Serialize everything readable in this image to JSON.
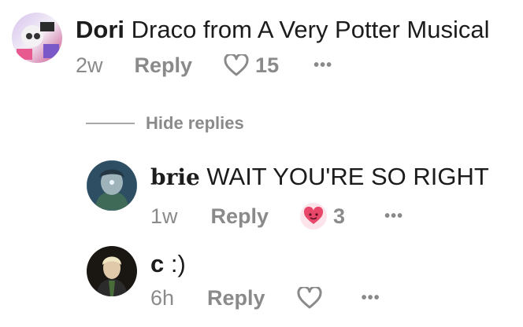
{
  "comments": [
    {
      "author": "Dori",
      "text": "Draco from A Very Potter Musical",
      "time": "2w",
      "reply_label": "Reply",
      "likes": "15",
      "more": "•••"
    },
    {
      "author": "brie",
      "text": "WAIT YOU'RE SO RIGHT",
      "time": "1w",
      "reply_label": "Reply",
      "likes": "3",
      "more": "•••"
    },
    {
      "author": "c",
      "text": ":)",
      "time": "6h",
      "reply_label": "Reply",
      "more": "•••"
    }
  ],
  "hide_replies_label": "Hide replies",
  "icons": {
    "heart": "heart-outline-icon",
    "reaction": "heart-face-emoji-icon",
    "more": "more-dots-icon"
  },
  "colors": {
    "meta_text": "#8a8a8a",
    "reaction_bg": "#fde3ea",
    "reaction_face": "#e8476a"
  }
}
